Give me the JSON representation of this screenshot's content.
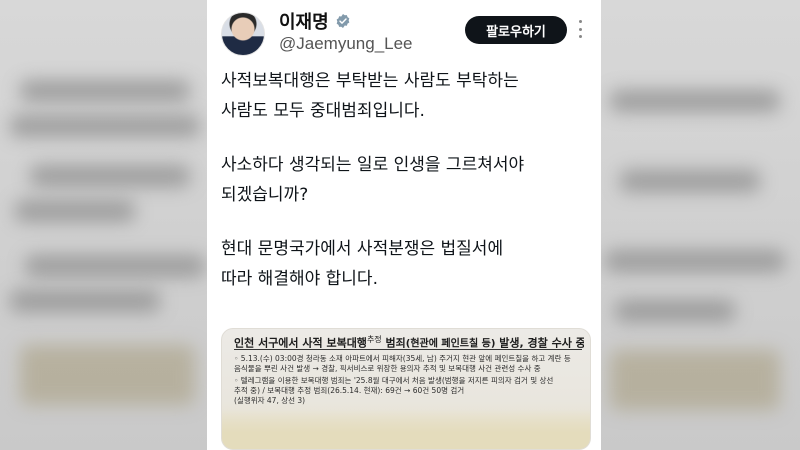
{
  "profile": {
    "name": "이재명",
    "handle": "@Jaemyung_Lee",
    "verified": true
  },
  "actions": {
    "follow_label": "팔로우하기"
  },
  "icons": {
    "verified": "verified-badge-icon",
    "more": "more-options-icon"
  },
  "colors": {
    "verified_badge": "#829aab",
    "follow_button_bg": "#0f1419",
    "text": "#0f1419"
  },
  "tweet": {
    "paragraphs": [
      [
        "사적보복대행은 부탁받는 사람도 부탁하는",
        "사람도 모두 중대범죄입니다."
      ],
      [
        "사소하다 생각되는 일로 인생을 그르쳐서야",
        "되겠습니까?"
      ],
      [
        "현대 문명국가에서 사적분쟁은 법질서에",
        "따라 해결해야 합니다."
      ]
    ]
  },
  "media": {
    "title_pre": "인천 서구에서 사적 보복대행",
    "title_sup": "추정",
    "title_mid": " 범죄",
    "title_bracket": "(현관에 페인트칠 등)",
    "title_post": " 발생, 경찰 수사 중",
    "lines": [
      "◦ 5.13.(수) 03:00경 청라동 소재 아파트에서 피해자(35세, 남) 주거지 현관 앞에 페인트칠을 하고 계란 등",
      "  음식물을 뿌린 사건 발생 → 경찰, 픽서비스로 위장한 용의자 추적 및 보복대행 사건 관련성 수사 중",
      "◦ 텔레그램을 이용한 보복대행 범죄는 '25.8월 대구에서 처음 발생(범행을 저지른 피의자 검거 및 상선",
      "  추적 중) / 보복대행 추정 범죄(26.5.14. 현재): 69건 → 60건 50명 검거",
      "  (실행위자 47, 상선 3)"
    ]
  }
}
